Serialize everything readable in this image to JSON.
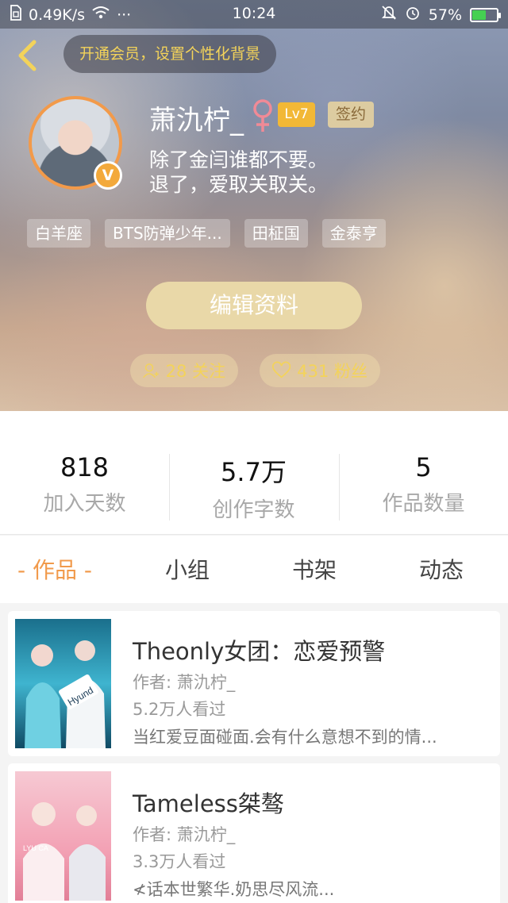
{
  "status_bar": {
    "speed": "0.49K/s",
    "more": "···",
    "time": "10:24",
    "battery": "57%",
    "battery_level": 0.57
  },
  "header": {
    "vip_banner": "开通会员，设置个性化背景",
    "username": "萧氿柠_",
    "gender_symbol": "♀",
    "level": "Lv7",
    "signed_badge": "签约",
    "vip_badge": "V",
    "bio": [
      "除了金闫谁都不要。",
      "退了，爱取关取关。"
    ],
    "tags": [
      "白羊座",
      "BTS防弹少年...",
      "田柾国",
      "金泰亨"
    ],
    "edit_button": "编辑资料",
    "following": "28 关注",
    "fans": "431 粉丝"
  },
  "stats": [
    {
      "value": "818",
      "label": "加入天数"
    },
    {
      "value": "5.7万",
      "label": "创作字数"
    },
    {
      "value": "5",
      "label": "作品数量"
    }
  ],
  "tabs": [
    {
      "label": "- 作品 -",
      "active": true
    },
    {
      "label": "小组",
      "active": false
    },
    {
      "label": "书架",
      "active": false
    },
    {
      "label": "动态",
      "active": false
    }
  ],
  "works": [
    {
      "title": "Theonly女团：恋爱预警",
      "author": "作者: 萧氿柠_",
      "views": "5.2万人看过",
      "description": "当红爱豆面碰面.会有什么意想不到的情...",
      "cover_text": "Hyund"
    },
    {
      "title": "Tameless桀骜",
      "author": "作者: 萧氿柠_",
      "views": "3.3万人看过",
      "description": "≮话本世繁华.奶思尽风流...",
      "cover_text": "LYU CA"
    }
  ],
  "colors": {
    "accent_orange": "#f19a4b",
    "gold_text": "#f3d35a",
    "level_badge": "#f2b836",
    "edit_button": "#e9d8a8"
  }
}
